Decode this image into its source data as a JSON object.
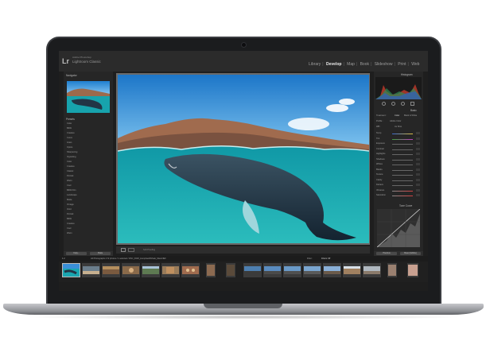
{
  "app": {
    "logo": "Lr",
    "product_line1": "Adobe Photoshop",
    "product_line2": "Lightroom Classic"
  },
  "modules": [
    {
      "label": "Library",
      "active": false
    },
    {
      "label": "Develop",
      "active": true
    },
    {
      "label": "Map",
      "active": false
    },
    {
      "label": "Book",
      "active": false
    },
    {
      "label": "Slideshow",
      "active": false
    },
    {
      "label": "Print",
      "active": false
    },
    {
      "label": "Web",
      "active": false
    }
  ],
  "left_panel": {
    "navigator_title": "Navigator",
    "presets_title": "Presets",
    "preset_items": [
      "Color",
      "B&W",
      "Creative",
      "Curve",
      "Grain",
      "Optics",
      "Sharpening",
      "Vignetting",
      "Color",
      "Creative",
      "Classic",
      "Portrait",
      "Warm",
      "Cool",
      "B&W Film",
      "Landscape",
      "Matte",
      "Vintage",
      "Vivid",
      "Portrait",
      "B&W",
      "Creative",
      "Cool",
      "Warm"
    ],
    "copy_label": "Copy...",
    "paste_label": "Paste"
  },
  "right_panel": {
    "histogram_title": "Histogram",
    "basic_title": "Basic",
    "treatment_label": "Treatment :",
    "color_label": "Color",
    "bw_label": "Black & White",
    "profile_label": "Profile :",
    "profile_value": "Adobe Color",
    "wb_label": "WB :",
    "wb_value": "As Shot",
    "sliders": [
      "Temp",
      "Tint",
      "Exposure",
      "Contrast",
      "Highlights",
      "Shadows",
      "Whites",
      "Blacks",
      "Texture",
      "Clarity",
      "Dehaze",
      "Vibrance",
      "Saturation"
    ],
    "tone_curve_title": "Tone Curve",
    "previous_label": "Previous",
    "reset_label": "Reset (Adobe)"
  },
  "toolbar": {
    "soft_proofing_label": "Soft Proofing"
  },
  "filmstrip_info": {
    "page_label": "1 2",
    "path_text": "All Photographs    172 photos / 1 selected / DSC_9318_HumpbackWhale_Maui.NEF",
    "filter_label": "Filter :",
    "filter_value": "Filters Off"
  },
  "colors": {
    "sky_top": "#1f7fd0",
    "sky_bottom": "#7fc4ef",
    "water": "#1aa6b0",
    "lr_panel": "#262626",
    "active_module": "#e8e8e8"
  }
}
